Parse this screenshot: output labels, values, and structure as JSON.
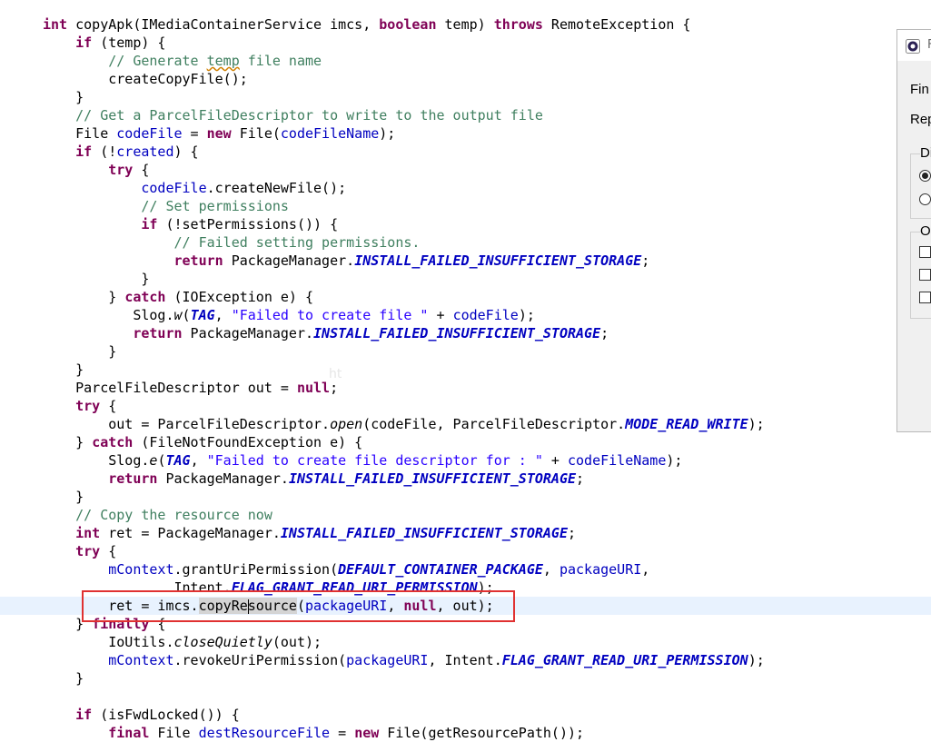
{
  "editor": {
    "lines": [
      "int copyApk(IMediaContainerService imcs, boolean temp) throws RemoteException {",
      "    if (temp) {",
      "        // Generate temp file name",
      "        createCopyFile();",
      "    }",
      "    // Get a ParcelFileDescriptor to write to the output file",
      "    File codeFile = new File(codeFileName);",
      "    if (!created) {",
      "        try {",
      "            codeFile.createNewFile();",
      "            // Set permissions",
      "            if (!setPermissions()) {",
      "                // Failed setting permissions.",
      "                return PackageManager.INSTALL_FAILED_INSUFFICIENT_STORAGE;",
      "            }",
      "        } catch (IOException e) {",
      "           Slog.w(TAG, \"Failed to create file \" + codeFile);",
      "           return PackageManager.INSTALL_FAILED_INSUFFICIENT_STORAGE;",
      "        }",
      "    }",
      "    ParcelFileDescriptor out = null;",
      "    try {",
      "        out = ParcelFileDescriptor.open(codeFile, ParcelFileDescriptor.MODE_READ_WRITE);",
      "    } catch (FileNotFoundException e) {",
      "        Slog.e(TAG, \"Failed to create file descriptor for : \" + codeFileName);",
      "        return PackageManager.INSTALL_FAILED_INSUFFICIENT_STORAGE;",
      "    }",
      "    // Copy the resource now",
      "    int ret = PackageManager.INSTALL_FAILED_INSUFFICIENT_STORAGE;",
      "    try {",
      "        mContext.grantUriPermission(DEFAULT_CONTAINER_PACKAGE, packageURI,",
      "                Intent.FLAG_GRANT_READ_URI_PERMISSION);",
      "        ret = imcs.copyResource(packageURI, null, out);",
      "    } finally {",
      "        IoUtils.closeQuietly(out);",
      "        mContext.revokeUriPermission(packageURI, Intent.FLAG_GRANT_READ_URI_PERMISSION);",
      "    }",
      "",
      "    if (isFwdLocked()) {",
      "        final File destResourceFile = new File(getResourcePath());"
    ],
    "highlighted_line_index": 32,
    "highlighted_symbol": "copyResource",
    "watermark": "ht"
  },
  "dialog": {
    "title": "F",
    "find_label": "Fin",
    "replace_label": "Rep",
    "direction_group": "Di",
    "options_group": "O"
  }
}
